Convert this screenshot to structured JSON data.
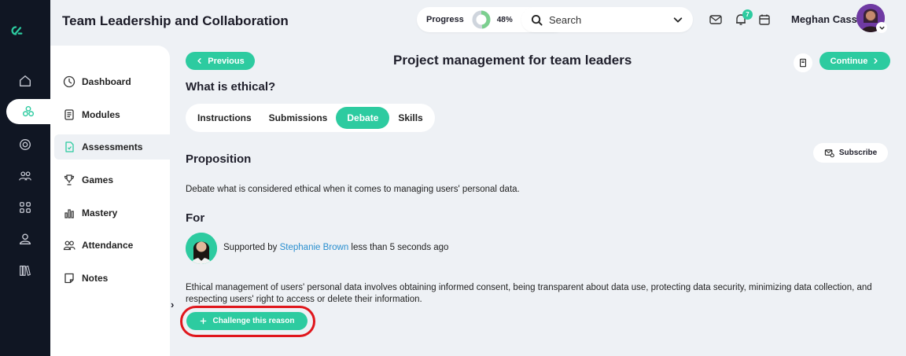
{
  "header": {
    "course_title": "Team Leadership and Collaboration",
    "progress_label": "Progress",
    "progress_value": "48%",
    "progress_fraction": 0.48,
    "search_placeholder": "Search",
    "notification_count": "7",
    "user_name": "Meghan Cass"
  },
  "rail": {
    "items": [
      "home-icon",
      "modules-cluster-icon",
      "target-icon",
      "team-icon",
      "grid-icon",
      "user-icon",
      "library-icon"
    ]
  },
  "sidenav": {
    "items": [
      {
        "label": "Dashboard",
        "icon": "dashboard-icon"
      },
      {
        "label": "Modules",
        "icon": "modules-icon"
      },
      {
        "label": "Assessments",
        "icon": "assessments-icon"
      },
      {
        "label": "Games",
        "icon": "trophy-icon"
      },
      {
        "label": "Mastery",
        "icon": "bar-chart-icon"
      },
      {
        "label": "Attendance",
        "icon": "attendance-icon"
      },
      {
        "label": "Notes",
        "icon": "notes-icon"
      }
    ]
  },
  "main": {
    "previous_label": "Previous",
    "page_title": "Project management for team leaders",
    "continue_label": "Continue",
    "question": "What is ethical?",
    "tabs": [
      "Instructions",
      "Submissions",
      "Debate",
      "Skills"
    ],
    "subscribe_label": "Subscribe",
    "proposition_heading": "Proposition",
    "proposition_text": "Debate what is considered ethical when it comes to managing users' personal data.",
    "for_heading": "For",
    "supported_by": "Supported by",
    "supporter_name": "Stephanie Brown",
    "supported_time": "less than 5 seconds ago",
    "reason_text": "Ethical management of users' personal data involves obtaining informed consent, being transparent about data use, protecting data security, minimizing data collection, and respecting users' right to access or delete their information.",
    "challenge_label": "Challenge this reason"
  },
  "colors": {
    "accent": "#2dcba0",
    "rail_bg": "#101623",
    "page_bg": "#eef1f5",
    "highlight_outline": "#e0161c",
    "link": "#2a8fcf"
  }
}
